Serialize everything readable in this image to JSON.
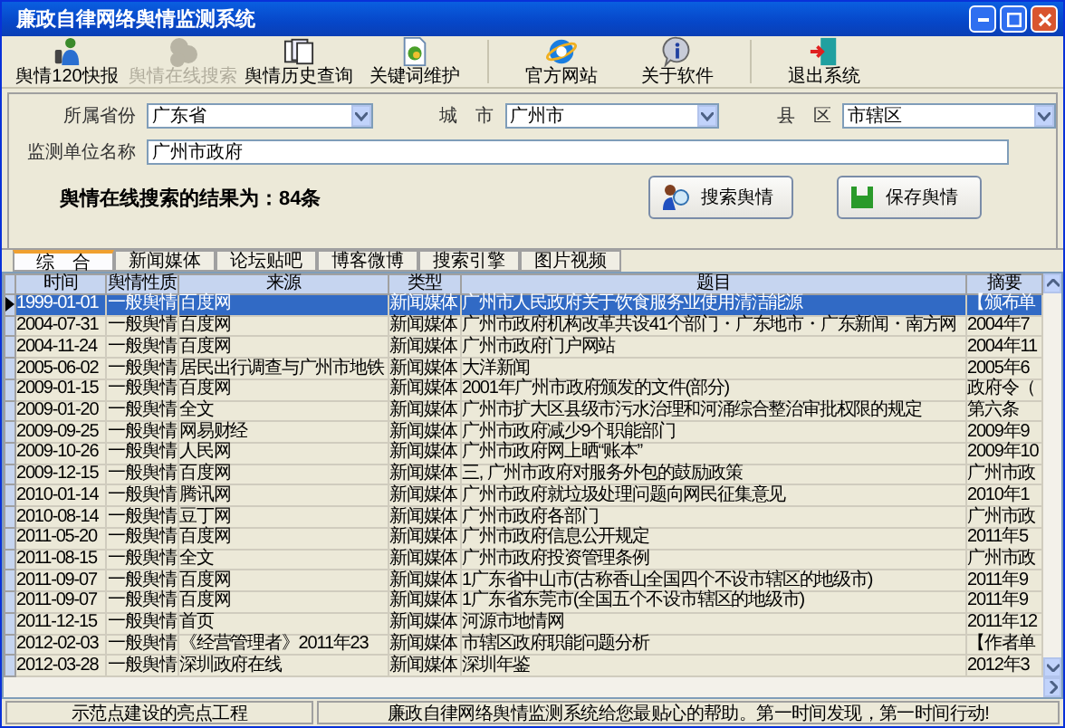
{
  "window": {
    "title": "廉政自律网络舆情监测系统"
  },
  "toolbar": [
    {
      "label": "舆情120快报",
      "kind": "people",
      "disabled": false
    },
    {
      "label": "舆情在线搜索",
      "kind": "cloud",
      "disabled": true
    },
    {
      "label": "舆情历史查询",
      "kind": "pages",
      "disabled": false
    },
    {
      "label": "关键词维护",
      "kind": "doc",
      "disabled": false
    },
    {
      "label": "官方网站",
      "kind": "web",
      "disabled": false
    },
    {
      "label": "关于软件",
      "kind": "info",
      "disabled": false
    },
    {
      "label": "退出系统",
      "kind": "exit",
      "disabled": false
    }
  ],
  "form": {
    "province": {
      "label": "所属省份",
      "value": "广东省"
    },
    "city": {
      "label": "城　市",
      "value": "广州市"
    },
    "district": {
      "label": "县　区",
      "value": "市辖区"
    },
    "unit": {
      "label": "监测单位名称",
      "value": "广州市政府"
    },
    "result": "舆情在线搜索的结果为：84条",
    "search_button": "搜索舆情",
    "save_button": "保存舆情"
  },
  "tabs": [
    {
      "label": "综　合",
      "selected": true
    },
    {
      "label": "新闻媒体",
      "selected": false
    },
    {
      "label": "论坛贴吧",
      "selected": false
    },
    {
      "label": "博客微博",
      "selected": false
    },
    {
      "label": "搜索引擎",
      "selected": false
    },
    {
      "label": "图片视频",
      "selected": false
    }
  ],
  "table": {
    "columns": [
      "时间",
      "舆情性质",
      "来源",
      "类型",
      "题目",
      "摘要"
    ],
    "rows": [
      {
        "selected": true,
        "cells": [
          "1999-01-01",
          "一般舆情",
          "百度网",
          "新闻媒体",
          "广州市人民政府关于饮食服务业使用清洁能源",
          "【颁布单"
        ]
      },
      {
        "selected": false,
        "cells": [
          "2004-07-31",
          "一般舆情",
          "百度网",
          "新闻媒体",
          "广州市政府机构改革共设41个部门・广东地市・广东新闻・南方网",
          "2004年7"
        ]
      },
      {
        "selected": false,
        "cells": [
          "2004-11-24",
          "一般舆情",
          "百度网",
          "新闻媒体",
          "广州市政府门户网站",
          "2004年11"
        ]
      },
      {
        "selected": false,
        "cells": [
          "2005-06-02",
          "一般舆情",
          "居民出行调查与广州市地铁",
          "新闻媒体",
          "大洋新闻",
          "2005年6"
        ]
      },
      {
        "selected": false,
        "cells": [
          "2009-01-15",
          "一般舆情",
          "百度网",
          "新闻媒体",
          "2001年广州市政府颁发的文件(部分)",
          "政府令（"
        ]
      },
      {
        "selected": false,
        "cells": [
          "2009-01-20",
          "一般舆情",
          "全文",
          "新闻媒体",
          "广州市扩大区县级市污水治理和河涌综合整治审批权限的规定",
          "第六条"
        ]
      },
      {
        "selected": false,
        "cells": [
          "2009-09-25",
          "一般舆情",
          "网易财经",
          "新闻媒体",
          "广州市政府减少9个职能部门",
          "2009年9"
        ]
      },
      {
        "selected": false,
        "cells": [
          "2009-10-26",
          "一般舆情",
          "人民网",
          "新闻媒体",
          "广州市政府网上晒“账本”",
          "2009年10"
        ]
      },
      {
        "selected": false,
        "cells": [
          "2009-12-15",
          "一般舆情",
          "百度网",
          "新闻媒体",
          "三, 广州市政府对服务外包的鼓励政策",
          "广州市政"
        ]
      },
      {
        "selected": false,
        "cells": [
          "2010-01-14",
          "一般舆情",
          "腾讯网",
          "新闻媒体",
          "广州市政府就垃圾处理问题向网民征集意见",
          "2010年1"
        ]
      },
      {
        "selected": false,
        "cells": [
          "2010-08-14",
          "一般舆情",
          "豆丁网",
          "新闻媒体",
          "广州市政府各部门",
          "广州市政"
        ]
      },
      {
        "selected": false,
        "cells": [
          "2011-05-20",
          "一般舆情",
          "百度网",
          "新闻媒体",
          "广州市政府信息公开规定",
          "2011年5"
        ]
      },
      {
        "selected": false,
        "cells": [
          "2011-08-15",
          "一般舆情",
          "全文",
          "新闻媒体",
          "广州市政府投资管理条例",
          "广州市政"
        ]
      },
      {
        "selected": false,
        "cells": [
          "2011-09-07",
          "一般舆情",
          "百度网",
          "新闻媒体",
          "1广东省中山市(古称香山全国四个不设市辖区的地级市)",
          "2011年9"
        ]
      },
      {
        "selected": false,
        "cells": [
          "2011-09-07",
          "一般舆情",
          "百度网",
          "新闻媒体",
          "1广东省东莞市(全国五个不设市辖区的地级市)",
          "2011年9"
        ]
      },
      {
        "selected": false,
        "cells": [
          "2011-12-15",
          "一般舆情",
          "首页",
          "新闻媒体",
          "河源市地情网",
          "2011年12"
        ]
      },
      {
        "selected": false,
        "cells": [
          "2012-02-03",
          "一般舆情",
          "《经营管理者》2011年23",
          "新闻媒体",
          "市辖区政府职能问题分析",
          "【作者单"
        ]
      },
      {
        "selected": false,
        "cells": [
          "2012-03-28",
          "一般舆情",
          "深圳政府在线",
          "新闻媒体",
          "深圳年鉴",
          "2012年3"
        ]
      }
    ]
  },
  "status_bar": [
    "示范点建设的亮点工程",
    "廉政自律网络舆情监测系统给您最贴心的帮助。第一时间发现，第一时间行动!"
  ]
}
